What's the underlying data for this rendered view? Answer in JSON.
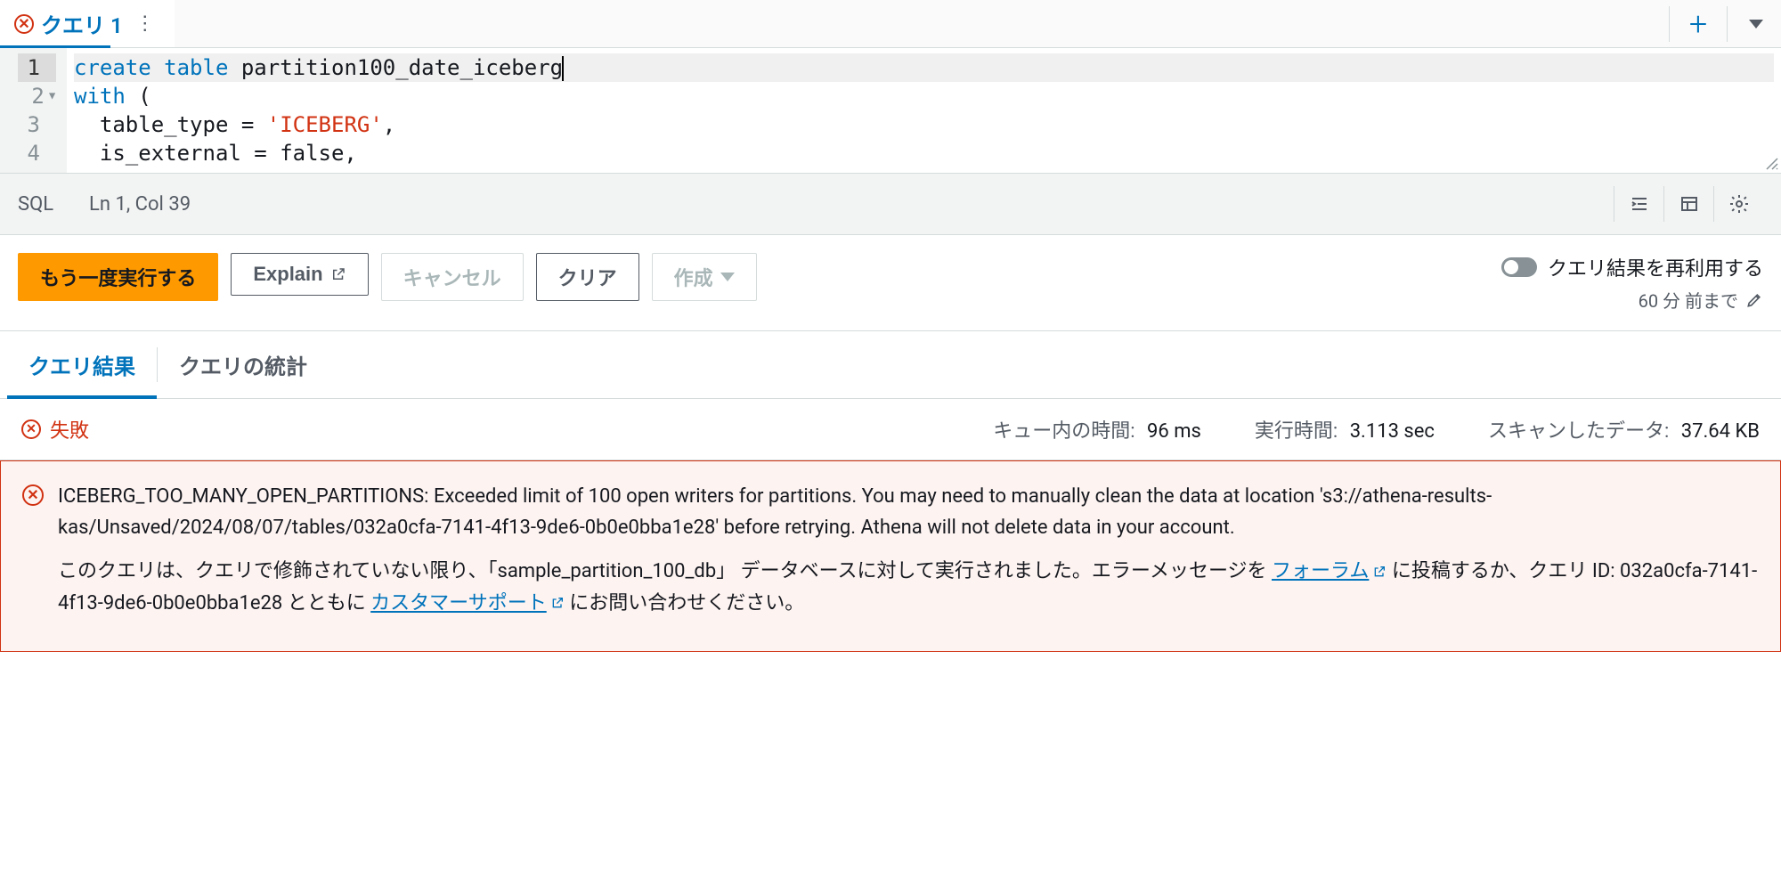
{
  "tab": {
    "title": "クエリ 1"
  },
  "editor": {
    "lines": [
      {
        "n": 1,
        "content_html": "<span class='kw'>create</span> <span class='kw'>table</span> partition100_date_iceberg",
        "fold": false,
        "current": true,
        "cursor": true
      },
      {
        "n": 2,
        "content_html": "<span class='kw'>with</span> (",
        "fold": true
      },
      {
        "n": 3,
        "content_html": "  table_type = <span class='str'>'ICEBERG'</span>,",
        "fold": false
      },
      {
        "n": 4,
        "content_html": "  is_external = false,",
        "fold": false
      }
    ]
  },
  "statusbar": {
    "lang": "SQL",
    "pos": "Ln 1, Col 39"
  },
  "actions": {
    "run": "もう一度実行する",
    "explain": "Explain",
    "cancel": "キャンセル",
    "clear": "クリア",
    "create": "作成",
    "reuse_label": "クエリ結果を再利用する",
    "reuse_age": "60 分 前まで"
  },
  "result_tabs": {
    "results": "クエリ結果",
    "stats": "クエリの統計"
  },
  "status": {
    "fail_label": "失敗",
    "queue_label": "キュー内の時間:",
    "queue_value": "96 ms",
    "exec_label": "実行時間:",
    "exec_value": "3.113 sec",
    "scan_label": "スキャンしたデータ:",
    "scan_value": "37.64 KB"
  },
  "error": {
    "msg1": "ICEBERG_TOO_MANY_OPEN_PARTITIONS: Exceeded limit of 100 open writers for partitions. You may need to manually clean the data at location 's3://athena-results-kas/Unsaved/2024/08/07/tables/032a0cfa-7141-4f13-9de6-0b0e0bba1e28' before retrying. Athena will not delete data in your account.",
    "msg2_prefix": "このクエリは、クエリで修飾されていない限り、「sample_partition_100_db」 データベースに対して実行されました。エラーメッセージを ",
    "forum_link": "フォーラム",
    "msg2_mid": " に投稿するか、クエリ ID: 032a0cfa-7141-4f13-9de6-0b0e0bba1e28 とともに ",
    "support_link": "カスタマーサポート",
    "msg2_suffix": " にお問い合わせください。"
  }
}
